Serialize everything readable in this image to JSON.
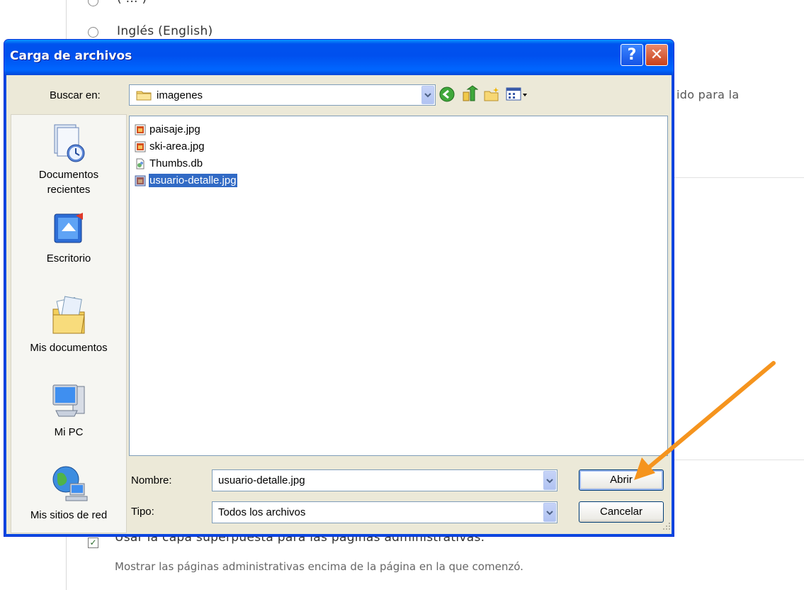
{
  "background": {
    "radio_label_cut": "( ... )",
    "radio_english": "Inglés (English)",
    "text_right": "ido para la",
    "overlay_checkbox_label": "Usar la capa superpuesta para las páginas administrativas.",
    "overlay_description": "Mostrar las páginas administrativas encima de la página en la que comenzó."
  },
  "dialog": {
    "title": "Carga de archivos",
    "help_glyph": "?",
    "close_glyph": "✕",
    "look_in_label": "Buscar en:",
    "look_in_value": "imagenes",
    "places": [
      {
        "label_line1": "Documentos",
        "label_line2": "recientes",
        "icon": "recent-documents-icon"
      },
      {
        "label_line1": "Escritorio",
        "label_line2": "",
        "icon": "desktop-icon"
      },
      {
        "label_line1": "Mis documentos",
        "label_line2": "",
        "icon": "my-documents-icon"
      },
      {
        "label_line1": "Mi PC",
        "label_line2": "",
        "icon": "my-computer-icon"
      },
      {
        "label_line1": "Mis sitios de red",
        "label_line2": "",
        "icon": "network-places-icon"
      }
    ],
    "files": [
      {
        "name": "paisaje.jpg",
        "icon": "jpg-file-icon",
        "selected": false
      },
      {
        "name": "ski-area.jpg",
        "icon": "jpg-file-icon",
        "selected": false
      },
      {
        "name": "Thumbs.db",
        "icon": "db-file-icon",
        "selected": false
      },
      {
        "name": "usuario-detalle.jpg",
        "icon": "jpg-file-icon",
        "selected": true
      }
    ],
    "filename_label": "Nombre:",
    "filename_value": "usuario-detalle.jpg",
    "filetype_label": "Tipo:",
    "filetype_value": "Todos los archivos",
    "open_button": "Abrir",
    "cancel_button": "Cancelar"
  },
  "colors": {
    "titlebar": "#0054e3",
    "selection": "#316ac5",
    "annotation_arrow": "#f5941e"
  }
}
